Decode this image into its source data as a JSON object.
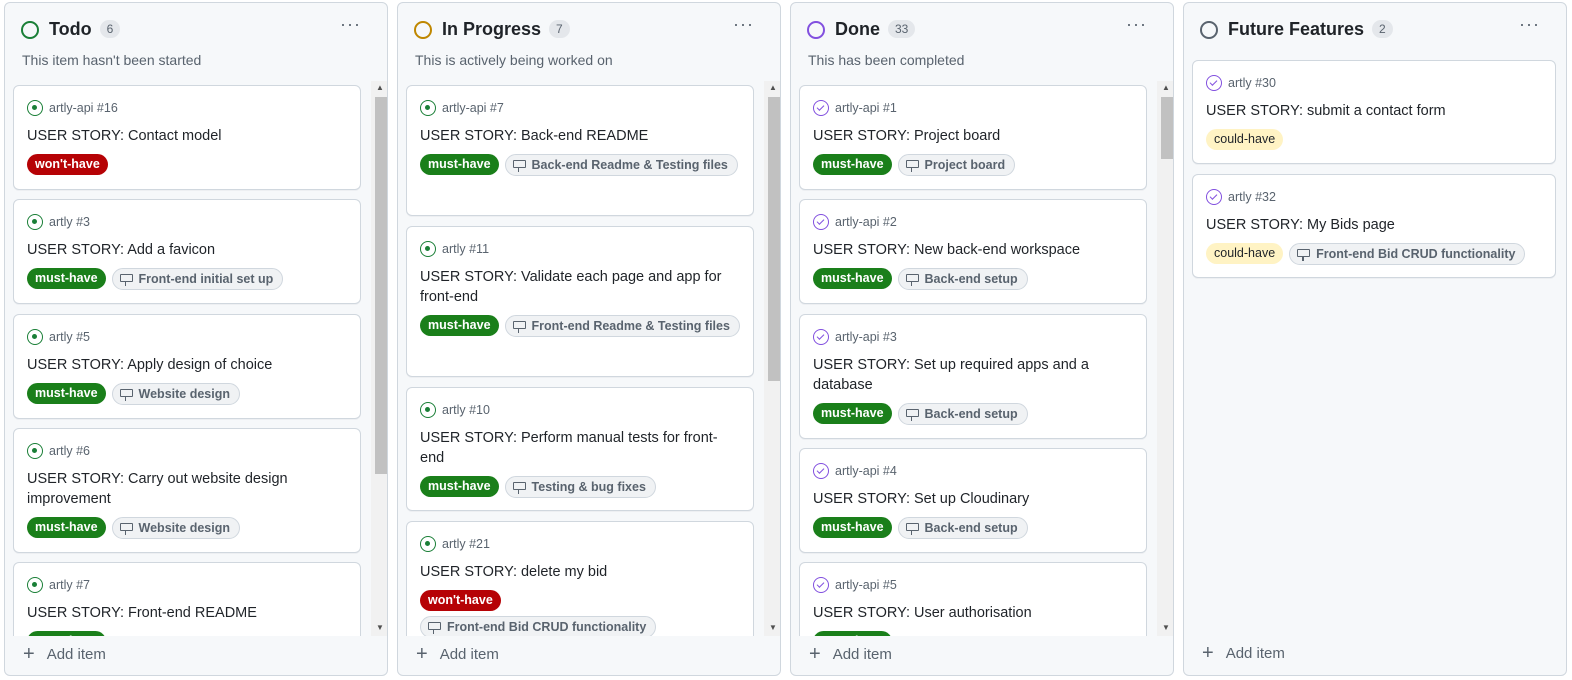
{
  "colors": {
    "todo": "#1a7f37",
    "in_progress": "#bf8700",
    "done": "#8250df",
    "future": "#59636e",
    "must_have": "#1a7f1a",
    "wont_have": "#b60205",
    "could_have": "#fff3c4"
  },
  "add_item_label": "Add item",
  "more_icon": "kebab-horizontal-icon",
  "columns": [
    {
      "title": "Todo",
      "count": "6",
      "description": "This item hasn't been started",
      "cards": [
        {
          "repo": "artly-api #16",
          "title": "USER STORY: Contact model",
          "label": "won't-have",
          "milestone": ""
        },
        {
          "repo": "artly #3",
          "title": "USER STORY: Add a favicon",
          "label": "must-have",
          "milestone": "Front-end initial set up"
        },
        {
          "repo": "artly #5",
          "title": "USER STORY: Apply design of choice",
          "label": "must-have",
          "milestone": "Website design"
        },
        {
          "repo": "artly #6",
          "title": "USER STORY: Carry out website design improvement",
          "label": "must-have",
          "milestone": "Website design"
        },
        {
          "repo": "artly #7",
          "title": "USER STORY: Front-end README",
          "label": "must-have",
          "milestone": ""
        }
      ]
    },
    {
      "title": "In Progress",
      "count": "7",
      "description": "This is actively being worked on",
      "cards": [
        {
          "repo": "artly-api #7",
          "title": "USER STORY: Back-end README",
          "label": "must-have",
          "milestone": "Back-end Readme & Testing files"
        },
        {
          "repo": "artly #11",
          "title": "USER STORY: Validate each page and app for front-end",
          "label": "must-have",
          "milestone": "Front-end Readme & Testing files"
        },
        {
          "repo": "artly #10",
          "title": "USER STORY: Perform manual tests for front-end",
          "label": "must-have",
          "milestone": "Testing & bug fixes"
        },
        {
          "repo": "artly #21",
          "title": "USER STORY: delete my bid",
          "label": "won't-have",
          "milestone": "Front-end Bid CRUD functionality"
        }
      ]
    },
    {
      "title": "Done",
      "count": "33",
      "description": "This has been completed",
      "cards": [
        {
          "repo": "artly-api #1",
          "title": "USER STORY: Project board",
          "label": "must-have",
          "milestone": "Project board"
        },
        {
          "repo": "artly-api #2",
          "title": "USER STORY: New back-end workspace",
          "label": "must-have",
          "milestone": "Back-end setup"
        },
        {
          "repo": "artly-api #3",
          "title": "USER STORY: Set up required apps and a database",
          "label": "must-have",
          "milestone": "Back-end setup"
        },
        {
          "repo": "artly-api #4",
          "title": "USER STORY: Set up Cloudinary",
          "label": "must-have",
          "milestone": "Back-end setup"
        },
        {
          "repo": "artly-api #5",
          "title": "USER STORY: User authorisation",
          "label": "must-have",
          "milestone": ""
        }
      ]
    },
    {
      "title": "Future Features",
      "count": "2",
      "description": "",
      "cards": [
        {
          "repo": "artly #30",
          "title": "USER STORY: submit a contact form",
          "label": "could-have",
          "milestone": ""
        },
        {
          "repo": "artly #32",
          "title": "USER STORY: My Bids page",
          "label": "could-have",
          "milestone": "Front-end Bid CRUD functionality"
        }
      ]
    }
  ]
}
